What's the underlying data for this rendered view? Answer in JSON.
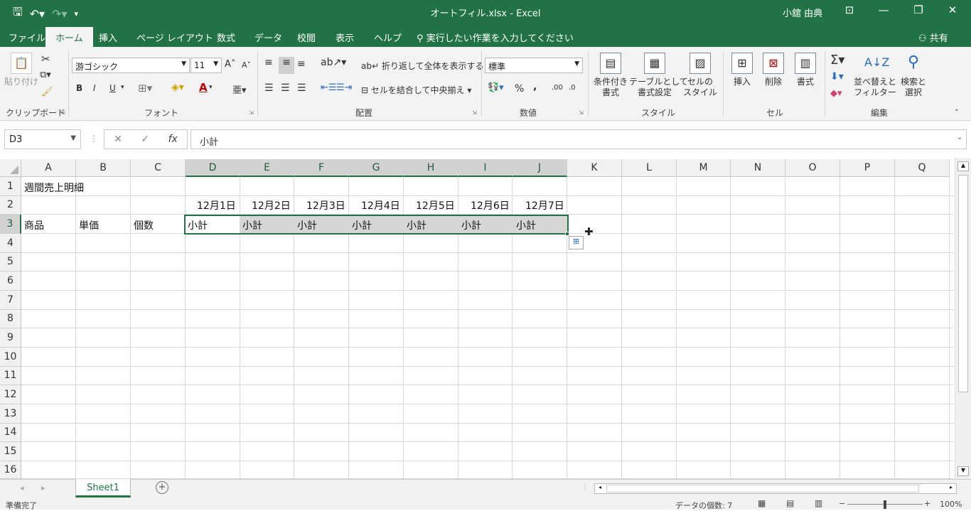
{
  "titlebar": {
    "save_icon": "save-icon",
    "undo_icon": "undo-icon",
    "redo_icon": "redo-icon",
    "title": "オートフィル.xlsx  -  Excel",
    "user": "小舘 由典"
  },
  "tabs": [
    "ファイル",
    "ホーム",
    "挿入",
    "ページ レイアウト",
    "数式",
    "データ",
    "校閲",
    "表示",
    "ヘルプ"
  ],
  "tell_me": "実行したい作業を入力してください",
  "share": "共有",
  "ribbon": {
    "clipboard": {
      "paste": "貼り付け",
      "label": "クリップボード"
    },
    "font": {
      "name": "游ゴシック",
      "size": "11",
      "bold": "B",
      "italic": "I",
      "underline": "U",
      "label": "フォント"
    },
    "alignment": {
      "wrap": "折り返して全体を表示する",
      "merge": "セルを結合して中央揃え",
      "label": "配置"
    },
    "number": {
      "format": "標準",
      "percent": "%",
      "comma": ",",
      "label": "数値"
    },
    "styles": {
      "cond": "条件付き\n書式",
      "table": "テーブルとして\n書式設定",
      "cell": "セルの\nスタイル",
      "label": "スタイル"
    },
    "cells": {
      "insert": "挿入",
      "delete": "削除",
      "format": "書式",
      "label": "セル"
    },
    "editing": {
      "sort": "並べ替えと\nフィルター",
      "find": "検索と\n選択",
      "label": "編集"
    }
  },
  "formula_bar": {
    "name_box": "D3",
    "cancel": "✕",
    "enter": "✓",
    "fx": "fx",
    "content": "小計"
  },
  "columns": [
    "A",
    "B",
    "C",
    "D",
    "E",
    "F",
    "G",
    "H",
    "I",
    "J",
    "K",
    "L",
    "M",
    "N",
    "O",
    "P",
    "Q"
  ],
  "rows": [
    "1",
    "2",
    "3",
    "4",
    "5",
    "6",
    "7",
    "8",
    "9",
    "10",
    "11",
    "12",
    "13",
    "14",
    "15",
    "16"
  ],
  "cells": {
    "A1": "週間売上明細",
    "dates": [
      "12月1日",
      "12月2日",
      "12月3日",
      "12月4日",
      "12月5日",
      "12月6日",
      "12月7日"
    ],
    "A3": "商品",
    "B3": "単価",
    "C3": "個数",
    "subtotals": [
      "小計",
      "小計",
      "小計",
      "小計",
      "小計",
      "小計",
      "小計"
    ]
  },
  "sheet_tab": "Sheet1",
  "status": {
    "ready": "準備完了",
    "count": "データの個数: 7",
    "zoom": "100%"
  }
}
